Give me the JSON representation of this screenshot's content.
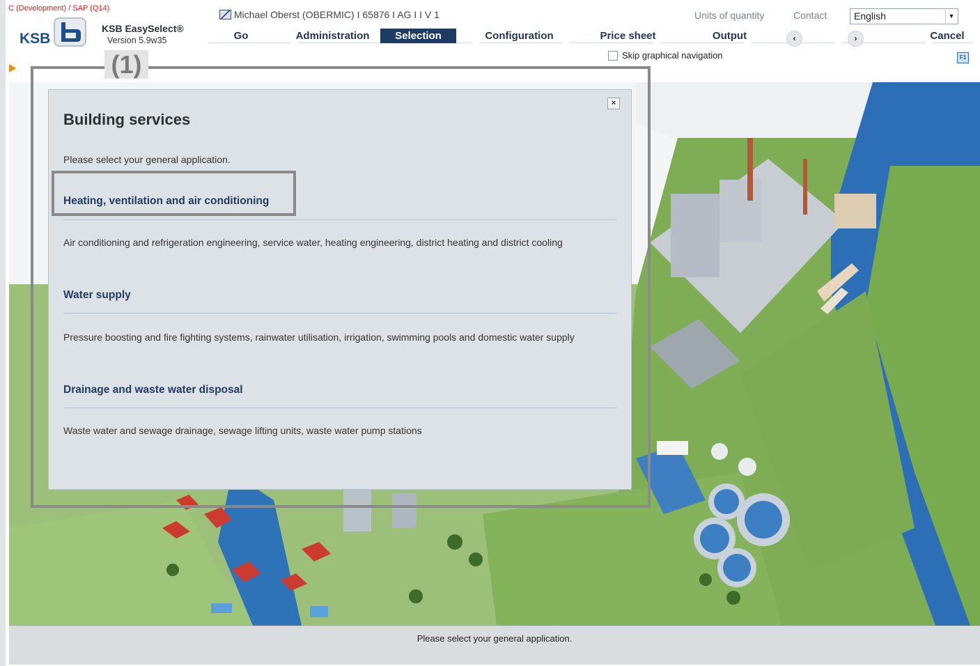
{
  "system": {
    "environment": "C (Development) / SAP (Q14)"
  },
  "app": {
    "name": "KSB EasySelect®",
    "version": "Version 5.9w35",
    "logo_text": "KSB"
  },
  "user_line": "Michael Oberst (OBERMIC)  I  65876  I  AG  I     I    V  1",
  "top_links": {
    "units": "Units of quantity",
    "contact": "Contact"
  },
  "language": {
    "selected": "English"
  },
  "nav": {
    "go": "Go",
    "administration": "Administration",
    "selection": "Selection",
    "configuration": "Configuration",
    "price_sheet": "Price sheet",
    "output": "Output",
    "cancel": "Cancel"
  },
  "skip_nav": {
    "label": "Skip graphical navigation",
    "checked": false
  },
  "help_icon_label": "F1",
  "annotation_label": "(1)",
  "dialog": {
    "title": "Building services",
    "prompt": "Please select your general application.",
    "close_glyph": "×",
    "applications": [
      {
        "title": "Heating, ventilation and air conditioning",
        "description": "Air conditioning and refrigeration engineering, service water, heating engineering, district heating and district cooling"
      },
      {
        "title": "Water supply",
        "description": "Pressure boosting and fire fighting systems, rainwater utilisation, irrigation, swimming pools and domestic water supply"
      },
      {
        "title": "Drainage and waste water disposal",
        "description": "Waste water and sewage drainage, sewage lifting units, waste water pump stations"
      }
    ]
  },
  "status": {
    "message": "Please select your general application."
  },
  "colors": {
    "nav_active": "#1c3c63",
    "heading_blue": "#1f3c61",
    "system_red": "#d4201a",
    "accent_orange": "#f18e00"
  },
  "icons": {
    "user": "user-window-icon",
    "prev": "chevron-left-icon",
    "next": "chevron-right-icon",
    "help": "help-icon",
    "close": "close-icon",
    "marker": "play-arrow-icon"
  }
}
